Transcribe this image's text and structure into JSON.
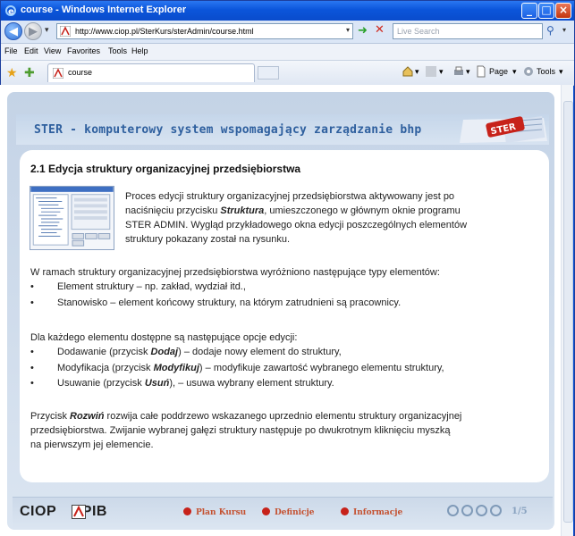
{
  "window": {
    "title": "course - Windows Internet Explorer",
    "address": "http://www.ciop.pl/SterKurs/sterAdmin/course.html",
    "search_placeholder": "Live Search"
  },
  "menu": [
    "File",
    "Edit",
    "View",
    "Favorites",
    "Tools",
    "Help"
  ],
  "tab": {
    "label": "course"
  },
  "commandbar": {
    "page": "Page",
    "tools": "Tools"
  },
  "page": {
    "header_title": "STER - komputerowy system wspomagający zarządzanie bhp",
    "logo_text": "STER",
    "section_title": "2.1 Edycja struktury organizacyjnej przedsiębiorstwa",
    "intro_lines": [
      "Proces edycji struktury organizacyjnej przedsiębiorstwa aktywowany jest po",
      "naciśnięciu przycisku Struktura, umieszczonego w głównym oknie programu",
      "STER ADMIN. Wygląd przykładowego okna edycji poszczególnych elementów",
      "struktury pokazany został na rysunku."
    ],
    "types_intro": "W ramach struktury organizacyjnej przedsiębiorstwa wyróżniono następujące typy elementów:",
    "types": [
      "Element struktury – np. zakład, wydział itd.,",
      "Stanowisko – element końcowy struktury, na którym zatrudnieni są pracownicy."
    ],
    "options_intro": "Dla każdego elementu dostępne są następujące opcje edycji:",
    "options": [
      {
        "pre": "Dodawanie (przycisk ",
        "bold": "Dodaj",
        "post": ") – dodaje nowy element do struktury,"
      },
      {
        "pre": "Modyfikacja (przycisk ",
        "bold": "Modyfikuj",
        "post": ") – modyfikuje zawartość wybranego elementu struktury,"
      },
      {
        "pre": "Usuwanie (przycisk ",
        "bold": "Usuń",
        "post": "), – usuwa wybrany element struktury."
      }
    ],
    "closing": [
      {
        "pre": "Przycisk ",
        "bold": "Rozwiń",
        "post": " rozwija całe poddrzewo wskazanego uprzednio elementu struktury organizacyjnej"
      },
      {
        "pre": "przedsiębiorstwa. Zwijanie wybranej gałęzi struktury następuje po dwukrotnym kliknięciu myszką",
        "bold": "",
        "post": ""
      },
      {
        "pre": "na pierwszym jej elemencie.",
        "bold": "",
        "post": ""
      }
    ]
  },
  "footer": {
    "brand_left": "CIOP",
    "brand_right": "PIB",
    "nav": [
      "Plan Kursu",
      "Definicje",
      "Informacje"
    ],
    "page_indicator": "1/5"
  }
}
